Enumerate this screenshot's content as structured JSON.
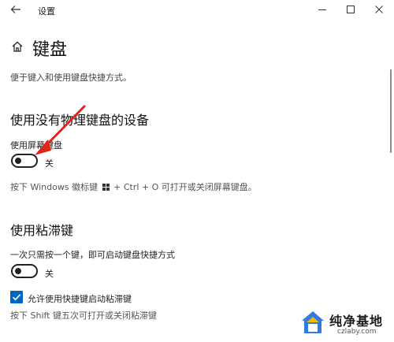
{
  "window": {
    "title": "设置",
    "back_icon": "back-arrow-icon",
    "controls": [
      "minimize-icon",
      "maximize-icon",
      "close-icon"
    ]
  },
  "page": {
    "icon": "home-icon",
    "title": "键盘",
    "description": "便于键入和使用键盘快捷方式。"
  },
  "on_screen_keyboard": {
    "section_title": "使用没有物理键盘的设备",
    "setting_label": "使用屏幕键盘",
    "toggle_state": "关",
    "toggle_on": false,
    "hint_prefix": "按下 Windows 徽标键",
    "hint_suffix": "+ Ctrl + O 可打开或关闭屏幕键盘。"
  },
  "sticky_keys": {
    "section_title": "使用粘滞键",
    "setting_label": "一次只需按一个键，即可启动键盘快捷方式",
    "toggle_state": "关",
    "toggle_on": false,
    "checkbox_label": "允许使用快捷键启动粘滞键",
    "checkbox_checked": true,
    "hint": "按下 Shift 键五次可打开或关闭粘滞键"
  },
  "watermark": {
    "name": "纯净基地",
    "url": "czlaby.com"
  },
  "colors": {
    "accent": "#0067c0",
    "annotation_arrow": "#e0261b",
    "watermark_blue": "#2f7be6",
    "watermark_yellow": "#f5b800"
  }
}
